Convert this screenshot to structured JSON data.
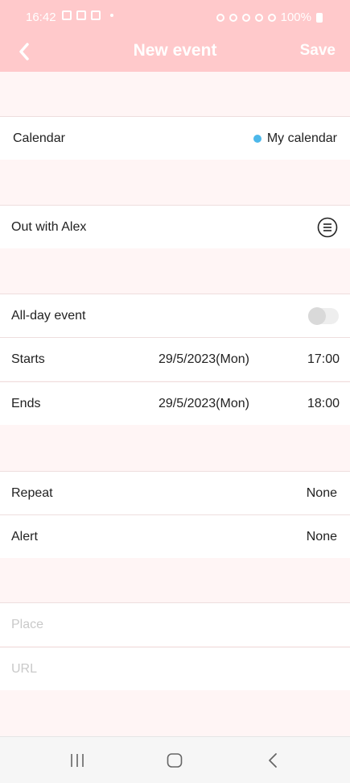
{
  "status_bar": {
    "time": "16:42",
    "battery_text": "100%"
  },
  "nav": {
    "back_icon": "chevron-left-icon",
    "title": "New event",
    "save_label": "Save"
  },
  "calendar": {
    "label": "Calendar",
    "value": "My calendar",
    "dot_color": "#4db8ea"
  },
  "title_field": {
    "value": "Out with Alex",
    "icon": "list-menu-icon"
  },
  "all_day": {
    "label": "All-day event",
    "enabled": false
  },
  "starts": {
    "label": "Starts",
    "date": "29/5/2023(Mon)",
    "time": "17:00"
  },
  "ends": {
    "label": "Ends",
    "date": "29/5/2023(Mon)",
    "time": "18:00"
  },
  "repeat": {
    "label": "Repeat",
    "value": "None"
  },
  "alert": {
    "label": "Alert",
    "value": "None"
  },
  "place": {
    "placeholder": "Place"
  },
  "url": {
    "placeholder": "URL"
  },
  "colors": {
    "header": "#ffc9cb",
    "background": "#fff5f5"
  }
}
